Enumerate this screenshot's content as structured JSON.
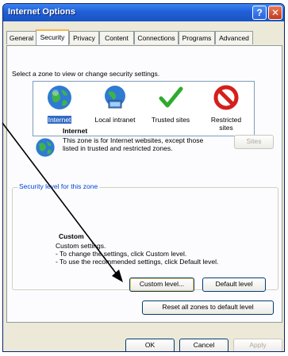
{
  "window": {
    "title": "Internet Options",
    "help_glyph": "?",
    "close_glyph": "✕"
  },
  "tabs": [
    {
      "label": "General",
      "active": false
    },
    {
      "label": "Security",
      "active": true
    },
    {
      "label": "Privacy",
      "active": false
    },
    {
      "label": "Content",
      "active": false
    },
    {
      "label": "Connections",
      "active": false
    },
    {
      "label": "Programs",
      "active": false
    },
    {
      "label": "Advanced",
      "active": false
    }
  ],
  "security": {
    "prompt": "Select a zone to view or change security settings.",
    "zones": [
      {
        "label": "Internet",
        "icon": "globe-icon",
        "selected": true
      },
      {
        "label": "Local intranet",
        "icon": "intranet-icon",
        "selected": false
      },
      {
        "label": "Trusted sites",
        "icon": "checkmark-icon",
        "selected": false
      },
      {
        "label": "Restricted sites",
        "icon": "restricted-icon",
        "selected": false
      }
    ],
    "zone_info": {
      "title": "Internet",
      "desc": "This zone is for Internet websites, except those listed in trusted and restricted zones."
    },
    "sites_button": "Sites",
    "level_group": {
      "legend": "Security level for this zone",
      "level_name": "Custom",
      "lines": [
        "Custom settings.",
        "- To change the settings, click Custom level.",
        "- To use the recommended settings, click Default level."
      ]
    },
    "custom_level_button": "Custom level...",
    "default_level_button": "Default level",
    "reset_button": "Reset all zones to default level"
  },
  "footer": {
    "ok": "OK",
    "cancel": "Cancel",
    "apply": "Apply"
  },
  "colors": {
    "titlebar": "#1f5fd6",
    "selection": "#316ac5",
    "group_legend": "#0046d5"
  }
}
